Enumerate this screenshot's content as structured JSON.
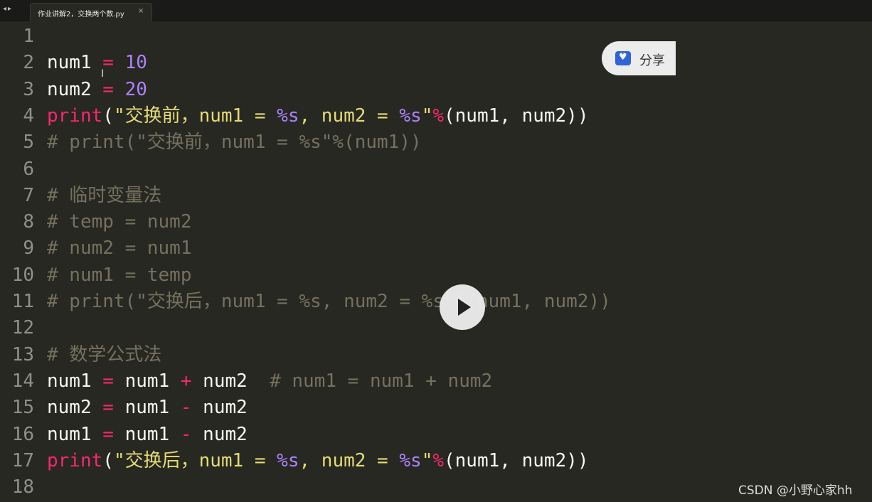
{
  "tabbar": {
    "back": "◂",
    "forward": "▸",
    "active_tab": {
      "label": "作业讲解2，交换两个数.py",
      "close": "×"
    }
  },
  "editor": {
    "lines": [
      {
        "n": "1",
        "tokens": []
      },
      {
        "n": "2",
        "tokens": [
          [
            "pl",
            "num1 "
          ],
          [
            "op",
            "="
          ],
          [
            "pl",
            " "
          ],
          [
            "nm",
            "10"
          ]
        ]
      },
      {
        "n": "3",
        "tokens": [
          [
            "pl",
            "num2 "
          ],
          [
            "op",
            "="
          ],
          [
            "pl",
            " "
          ],
          [
            "nm",
            "20"
          ]
        ]
      },
      {
        "n": "4",
        "tokens": [
          [
            "kw",
            "print"
          ],
          [
            "pl",
            "("
          ],
          [
            "st",
            "\"交换前，num1 = "
          ],
          [
            "fm",
            "%s"
          ],
          [
            "st",
            ", num2 = "
          ],
          [
            "fm",
            "%s"
          ],
          [
            "st",
            "\""
          ],
          [
            "op",
            "%"
          ],
          [
            "pl",
            "(num1, num2))"
          ]
        ]
      },
      {
        "n": "5",
        "tokens": [
          [
            "cm",
            "# print(\"交换前，num1 = %s\"%(num1))"
          ]
        ]
      },
      {
        "n": "6",
        "tokens": []
      },
      {
        "n": "7",
        "tokens": [
          [
            "cm",
            "# 临时变量法"
          ]
        ]
      },
      {
        "n": "8",
        "tokens": [
          [
            "cm",
            "# temp = num2"
          ]
        ]
      },
      {
        "n": "9",
        "tokens": [
          [
            "cm",
            "# num2 = num1"
          ]
        ]
      },
      {
        "n": "10",
        "tokens": [
          [
            "cm",
            "# num1 = temp"
          ]
        ]
      },
      {
        "n": "11",
        "tokens": [
          [
            "cm",
            "# print(\"交换后，num1 = %s, num2 = %s\"%(num1, num2))"
          ]
        ]
      },
      {
        "n": "12",
        "tokens": []
      },
      {
        "n": "13",
        "tokens": [
          [
            "cm",
            "# 数学公式法"
          ]
        ]
      },
      {
        "n": "14",
        "tokens": [
          [
            "pl",
            "num1 "
          ],
          [
            "op",
            "="
          ],
          [
            "pl",
            " num1 "
          ],
          [
            "op",
            "+"
          ],
          [
            "pl",
            " num2  "
          ],
          [
            "cm",
            "# num1 = num1 + num2"
          ]
        ]
      },
      {
        "n": "15",
        "tokens": [
          [
            "pl",
            "num2 "
          ],
          [
            "op",
            "="
          ],
          [
            "pl",
            " num1 "
          ],
          [
            "op",
            "-"
          ],
          [
            "pl",
            " num2"
          ]
        ]
      },
      {
        "n": "16",
        "tokens": [
          [
            "pl",
            "num1 "
          ],
          [
            "op",
            "="
          ],
          [
            "pl",
            " num1 "
          ],
          [
            "op",
            "-"
          ],
          [
            "pl",
            " num2"
          ]
        ]
      },
      {
        "n": "17",
        "tokens": [
          [
            "kw",
            "print"
          ],
          [
            "pl",
            "("
          ],
          [
            "st",
            "\"交换后，num1 = "
          ],
          [
            "fm",
            "%s"
          ],
          [
            "st",
            ", num2 = "
          ],
          [
            "fm",
            "%s"
          ],
          [
            "st",
            "\""
          ],
          [
            "op",
            "%"
          ],
          [
            "pl",
            "(num1, num2))"
          ]
        ]
      },
      {
        "n": "18",
        "tokens": []
      }
    ]
  },
  "overlay": {
    "share_label": "分享",
    "share_icon": "heart-shield-icon",
    "play_icon": "play-icon",
    "watermark": "CSDN @小野心家hh"
  },
  "colors": {
    "background": "#272822",
    "keyword": "#f92672",
    "string": "#e6db74",
    "number": "#ae81ff",
    "comment": "#75715e",
    "line_number": "#90908a"
  }
}
